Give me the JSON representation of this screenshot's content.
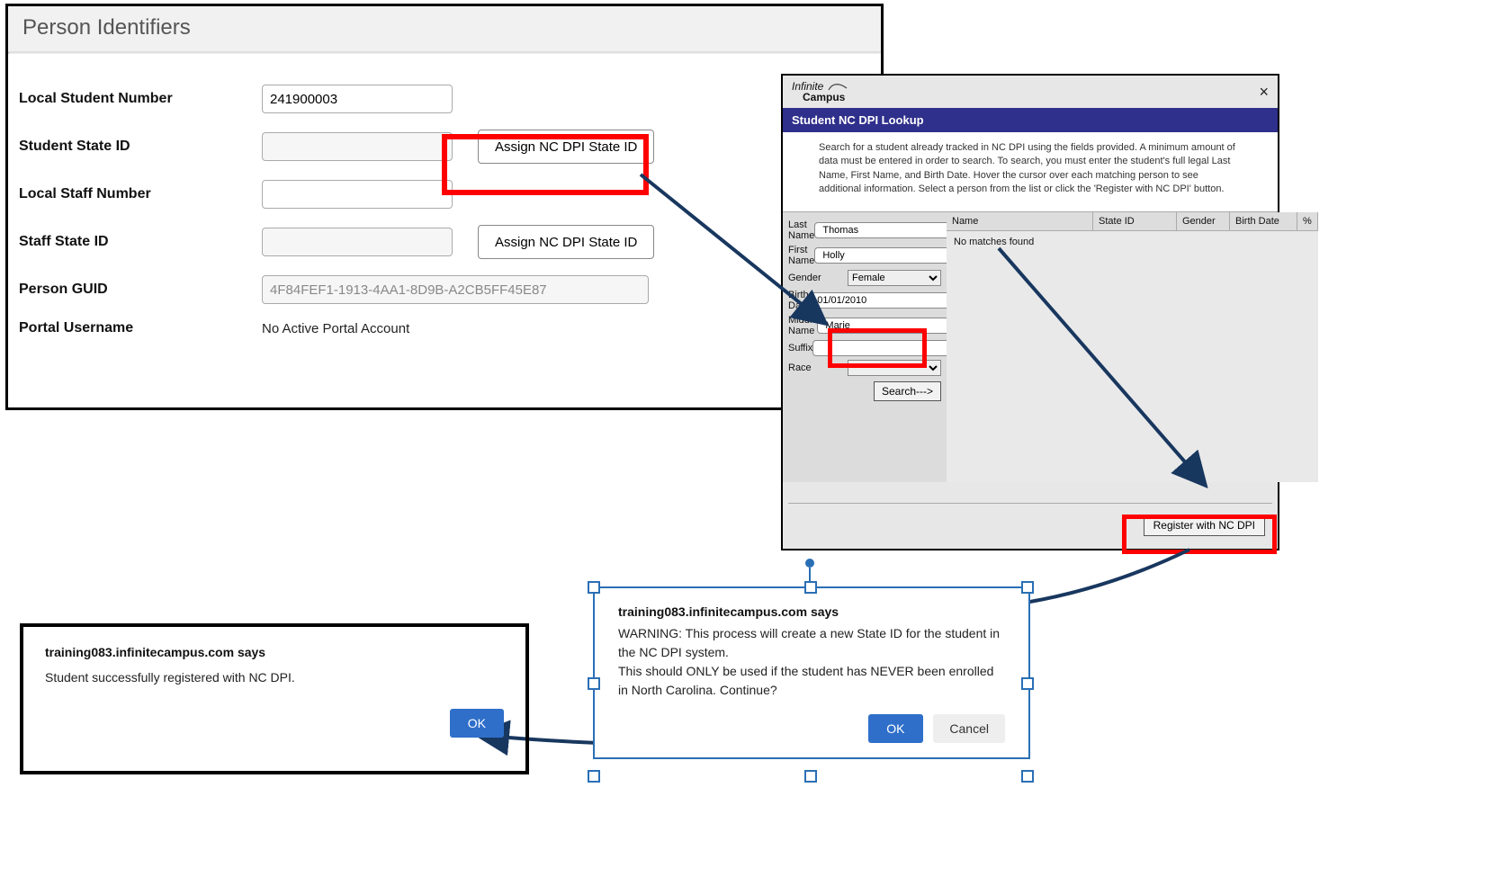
{
  "identifiers": {
    "panel_title": "Person Identifiers",
    "local_student_number": {
      "label": "Local Student Number",
      "value": "241900003"
    },
    "student_state_id": {
      "label": "Student State ID",
      "value": "",
      "assign_label": "Assign NC DPI State ID"
    },
    "local_staff_number": {
      "label": "Local Staff Number",
      "value": ""
    },
    "staff_state_id": {
      "label": "Staff State ID",
      "value": "",
      "assign_label": "Assign NC DPI State ID"
    },
    "person_guid": {
      "label": "Person GUID",
      "value": "4F84FEF1-1913-4AA1-8D9B-A2CB5FF45E87"
    },
    "portal_username": {
      "label": "Portal Username",
      "value": "No Active Portal Account"
    }
  },
  "lookup": {
    "brand_top": "Infinite",
    "brand_bottom": "Campus",
    "title": "Student NC DPI Lookup",
    "instructions": "Search for a student already tracked in NC DPI using the fields provided. A minimum amount of data must be entered in order to search. To search, you must enter the student's full legal Last Name, First Name, and Birth Date. Hover the cursor over each matching person to see additional information. Select a person from the list or click the 'Register with NC DPI' button.",
    "fields": {
      "last_name": {
        "label": "Last Name",
        "value": "Thomas"
      },
      "first_name": {
        "label": "First Name",
        "value": "Holly"
      },
      "gender": {
        "label": "Gender",
        "value": "Female"
      },
      "birth_date": {
        "label": "Birth Date",
        "value": "01/01/2010"
      },
      "middle_name": {
        "label": "Middle Name",
        "value": "Marie"
      },
      "suffix": {
        "label": "Suffix",
        "value": ""
      },
      "race": {
        "label": "Race",
        "value": ""
      }
    },
    "search_label": "Search--->",
    "results": {
      "columns": {
        "name": "Name",
        "state_id": "State ID",
        "gender": "Gender",
        "birth_date": "Birth Date",
        "pct": "%"
      },
      "empty_text": "No matches found"
    },
    "register_label": "Register with NC DPI"
  },
  "alert_warning": {
    "title": "training083.infinitecampus.com says",
    "body1": "WARNING: This process will create a new State ID for the student in the NC DPI system.",
    "body2": "This should ONLY be used if the student has NEVER been enrolled in North Carolina. Continue?",
    "ok_label": "OK",
    "cancel_label": "Cancel"
  },
  "alert_success": {
    "title": "training083.infinitecampus.com says",
    "body": "Student successfully registered with NC DPI.",
    "ok_label": "OK"
  }
}
